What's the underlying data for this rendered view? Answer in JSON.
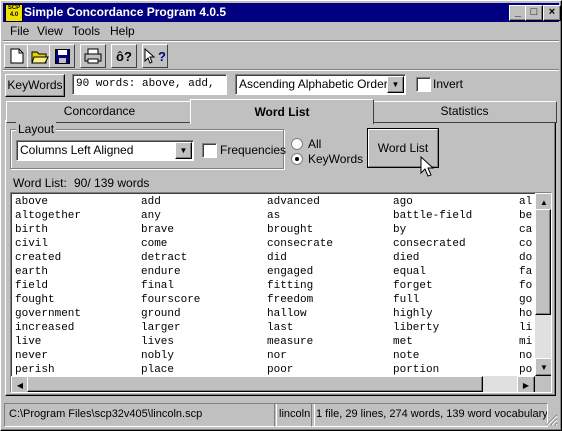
{
  "window": {
    "title": "Simple Concordance Program 4.0.5",
    "icon_text": "SCP 4.0",
    "controls": [
      "_",
      "□",
      "×"
    ]
  },
  "menu": [
    "File",
    "View",
    "Tools",
    "Help"
  ],
  "toolbar": {
    "icons": [
      "new-icon",
      "open-icon",
      "save-icon",
      "print-icon",
      "about-icon",
      "context-help-icon"
    ],
    "about_label": "ô?",
    "help_label": "?"
  },
  "keybar": {
    "keywords_label": "KeyWords",
    "keywords_value": "90 words: above, add,",
    "sort_value": "Ascending Alphabetic Order",
    "invert_label": "Invert"
  },
  "tabs": {
    "concordance": "Concordance",
    "word_list": "Word List",
    "statistics": "Statistics"
  },
  "layout": {
    "group_label": "Layout",
    "layout_value": "Columns Left Aligned",
    "frequencies_label": "Frequencies",
    "radio_all": "All",
    "radio_keywords": "KeyWords",
    "selected_radio": "KeyWords",
    "word_list_button": "Word List"
  },
  "word_list": {
    "label": "Word List:",
    "count": "90/ 139 words",
    "rows": [
      [
        "above",
        "add",
        "advanced",
        "ago",
        "al"
      ],
      [
        "altogether",
        "any",
        "as",
        "battle-field",
        "be"
      ],
      [
        "birth",
        "brave",
        "brought",
        "by",
        "ca"
      ],
      [
        "civil",
        "come",
        "consecrate",
        "consecrated",
        "co"
      ],
      [
        "created",
        "detract",
        "did",
        "died",
        "do"
      ],
      [
        "earth",
        "endure",
        "engaged",
        "equal",
        "fa"
      ],
      [
        "field",
        "final",
        "fitting",
        "forget",
        "fo"
      ],
      [
        "fought",
        "fourscore",
        "freedom",
        "full",
        "go"
      ],
      [
        "government",
        "ground",
        "hallow",
        "highly",
        "ho"
      ],
      [
        "increased",
        "larger",
        "last",
        "liberty",
        "li"
      ],
      [
        "live",
        "lives",
        "measure",
        "met",
        "mi"
      ],
      [
        "never",
        "nobly",
        "nor",
        "note",
        "no"
      ],
      [
        "perish",
        "place",
        "poor",
        "portion",
        "po"
      ]
    ]
  },
  "statusbar": {
    "path": "C:\\Program Files\\scp32v405\\lincoln.scp",
    "file": "lincoln",
    "summary": "1 file, 29 lines, 274 words, 139 word vocabulary"
  }
}
